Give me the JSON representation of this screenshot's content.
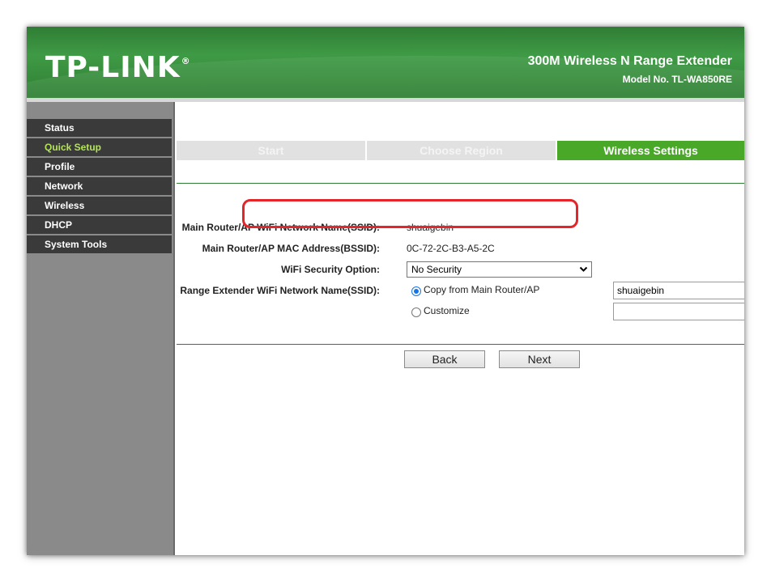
{
  "header": {
    "logo": "TP-LINK",
    "logo_mark": "®",
    "product_name": "300M Wireless N Range Extender",
    "model": "Model No. TL-WA850RE"
  },
  "sidebar": {
    "items": [
      {
        "label": "Status",
        "active": false
      },
      {
        "label": "Quick Setup",
        "active": true
      },
      {
        "label": "Profile",
        "active": false
      },
      {
        "label": "Network",
        "active": false
      },
      {
        "label": "Wireless",
        "active": false
      },
      {
        "label": "DHCP",
        "active": false
      },
      {
        "label": "System Tools",
        "active": false
      }
    ]
  },
  "steps": [
    {
      "label": "Start",
      "state": "done"
    },
    {
      "label": "Choose Region",
      "state": "done"
    },
    {
      "label": "Wireless Settings",
      "state": "current"
    }
  ],
  "form": {
    "main_ssid_label": "Main Router/AP WiFi Network Name(SSID):",
    "main_ssid_value": "shuaigebin",
    "main_mac_label": "Main Router/AP MAC Address(BSSID):",
    "main_mac_value": "0C-72-2C-B3-A5-2C",
    "security_label": "WiFi Security Option:",
    "security_value": "No Security",
    "extender_ssid_label": "Range Extender WiFi Network Name(SSID):",
    "copy_option_label": "Copy from Main Router/AP",
    "copy_option_value": "shuaigebin",
    "customize_label": "Customize",
    "customize_value": ""
  },
  "buttons": {
    "back": "Back",
    "next": "Next"
  },
  "colors": {
    "brand_green": "#3f9a45",
    "active_step": "#4aa829",
    "active_menu_text": "#b4e35a",
    "highlight_red": "#e4262a"
  }
}
